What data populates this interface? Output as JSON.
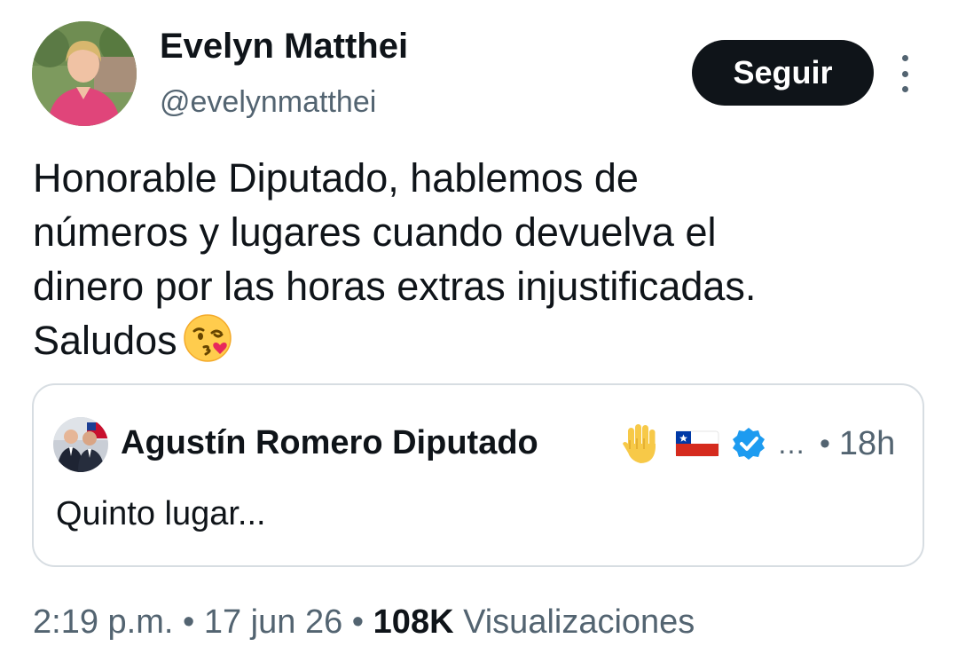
{
  "author": {
    "display_name": "Evelyn Matthei",
    "handle": "@evelynmatthei",
    "avatar": "profile-photo"
  },
  "actions": {
    "follow_label": "Seguir",
    "more_icon": "more-vertical-icon"
  },
  "tweet": {
    "lines": [
      "Honorable Diputado, hablemos de",
      "números y lugares cuando devuelva el",
      "dinero por las horas extras injustificadas.",
      "Saludos"
    ],
    "emoji": "face-blowing-kiss-emoji"
  },
  "quote": {
    "display_name": "Agustín Romero Diputado",
    "icons": [
      "raised-hand-emoji",
      "chile-flag-emoji",
      "verified-badge-icon"
    ],
    "ellipsis": "…",
    "separator": "•",
    "time": "18h",
    "text": "Quinto lugar..."
  },
  "footer": {
    "time": "2:19 p.m.",
    "separator": "•",
    "date": "17 jun 26",
    "views_count": "108K",
    "views_label": "Visualizaciones"
  },
  "colors": {
    "text_primary": "#0f1419",
    "text_secondary": "#536471",
    "button_bg": "#0f1419",
    "border": "#d7dde2",
    "verified": "#1d9bf0"
  }
}
